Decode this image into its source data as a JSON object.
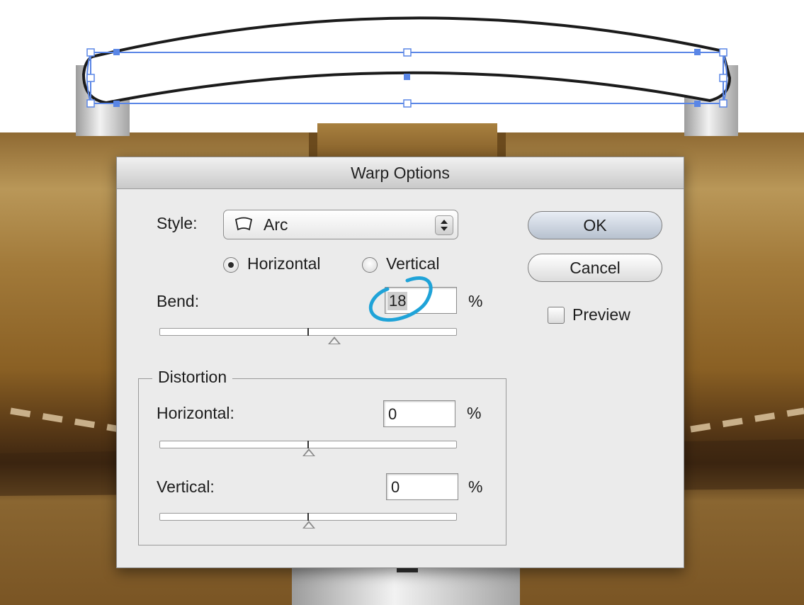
{
  "dialog": {
    "title": "Warp Options",
    "style_label": "Style:",
    "style_value": "Arc",
    "orientation": {
      "horizontal_label": "Horizontal",
      "vertical_label": "Vertical",
      "selected": "Horizontal"
    },
    "bend": {
      "label": "Bend:",
      "value": "18",
      "unit": "%"
    },
    "distortion": {
      "title": "Distortion",
      "horizontal": {
        "label": "Horizontal:",
        "value": "0",
        "unit": "%"
      },
      "vertical": {
        "label": "Vertical:",
        "value": "0",
        "unit": "%"
      }
    },
    "buttons": {
      "ok": "OK",
      "cancel": "Cancel"
    },
    "preview": {
      "label": "Preview",
      "checked": false
    }
  },
  "icons": {
    "arc_style": "arc-warp-icon",
    "stepper": "popup-stepper-icon",
    "annotation": "blue-circle-annotation"
  },
  "colors": {
    "accent_selection": "#5a86e6",
    "annotation": "#1fa3d8",
    "leather_dark": "#5a3a18",
    "leather_light": "#b08a4c"
  }
}
